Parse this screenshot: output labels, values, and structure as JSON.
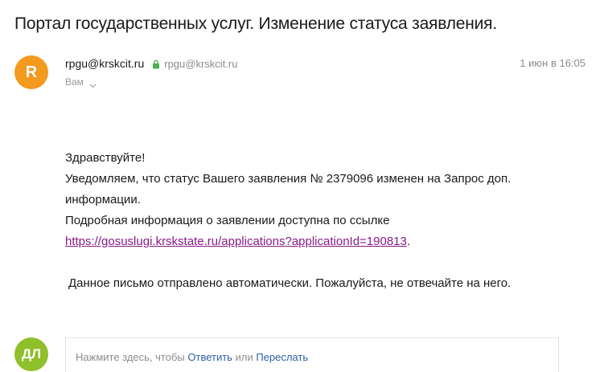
{
  "email": {
    "subject": "Портал государственных услуг. Изменение статуса заявления.",
    "sender": {
      "avatar_letter": "R",
      "name": "rpgu@krskcit.ru",
      "address": "rpgu@krskcit.ru",
      "avatar_color": "#f39a1f"
    },
    "date": "1 июн в 16:05",
    "recipient": "Вам",
    "body": {
      "greeting": "Здравствуйте!",
      "line1": "Уведомляем, что статус Вашего заявления № 2379096 изменен на Запрос доп. информации.",
      "line2": "Подробная информация о заявлении доступна по ссылке",
      "link": "https://gosuslugi.krskstate.ru/applications?applicationId=190813",
      "link_suffix": ".",
      "note": "Данное письмо отправлено автоматически. Пожалуйста, не отвечайте на него."
    }
  },
  "reply": {
    "avatar_initials": "ДЛ",
    "avatar_color": "#8fbf2a",
    "prompt_prefix": "Нажмите здесь, чтобы",
    "reply_label": "Ответить",
    "or_label": "или",
    "forward_label": "Переслать"
  },
  "icons": {
    "secure": "lock-icon",
    "recipients_toggle": "chevron-down-icon"
  },
  "colors": {
    "link": "#8a1a8a",
    "action": "#2d5fa7",
    "secure": "#4caf50"
  }
}
